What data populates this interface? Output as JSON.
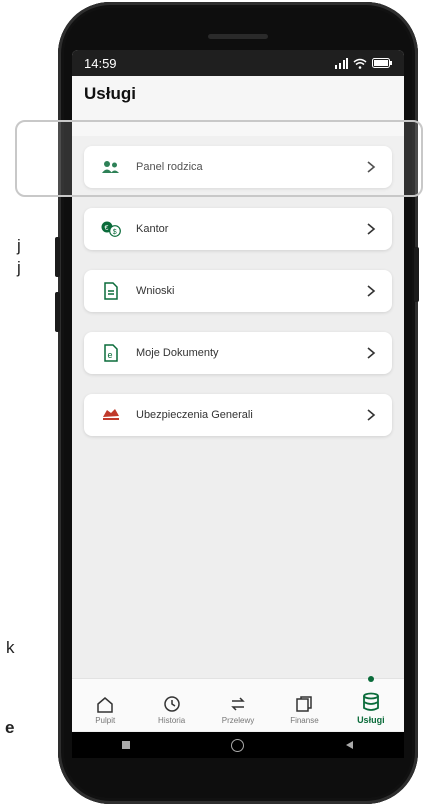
{
  "background_text": {
    "line1": "j",
    "line2": "j",
    "line3": "k",
    "line4": "e"
  },
  "status_bar": {
    "time": "14:59",
    "signal_icon": "signal-icon",
    "wifi_icon": "wifi-icon",
    "battery_icon": "battery-icon"
  },
  "header": {
    "title": "Usługi"
  },
  "services": [
    {
      "label": "Panel rodzica",
      "icon": "parents-icon"
    },
    {
      "label": "Kantor",
      "icon": "currency-exchange-icon"
    },
    {
      "label": "Wnioski",
      "icon": "document-icon"
    },
    {
      "label": "Moje Dokumenty",
      "icon": "e-document-icon"
    },
    {
      "label": "Ubezpieczenia Generali",
      "icon": "generali-logo-icon"
    }
  ],
  "bottom_nav": [
    {
      "label": "Pulpit",
      "icon": "home-icon"
    },
    {
      "label": "Historia",
      "icon": "history-icon"
    },
    {
      "label": "Przelewy",
      "icon": "transfer-icon"
    },
    {
      "label": "Finanse",
      "icon": "finance-icon"
    },
    {
      "label": "Usługi",
      "icon": "services-icon",
      "active": true
    }
  ],
  "colors": {
    "accent": "#0a6b3a",
    "card_bg": "#ffffff",
    "screen_bg": "#eeeeee"
  }
}
